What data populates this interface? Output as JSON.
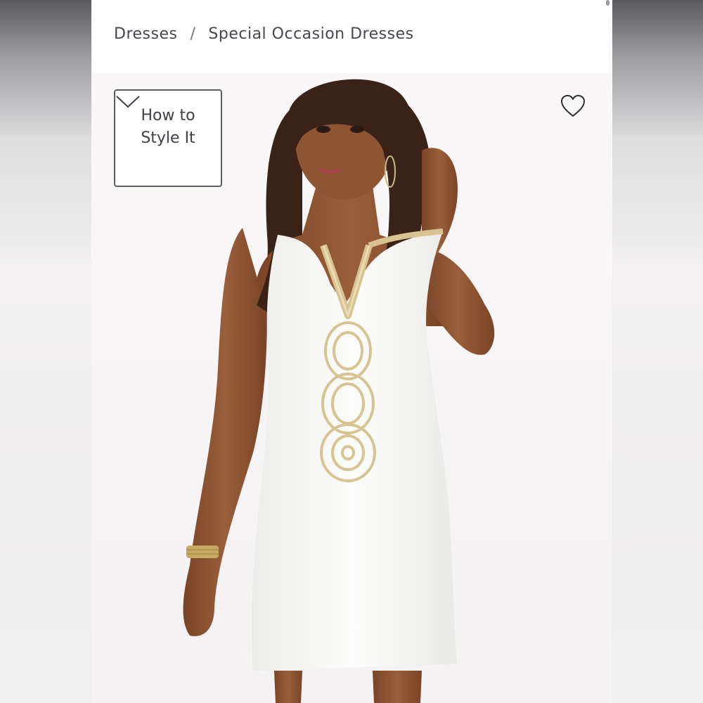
{
  "breadcrumb": {
    "items": [
      "Dresses",
      "Special Occasion Dresses"
    ],
    "separator": "/"
  },
  "style_it": {
    "label": "How to Style It",
    "icon": "chevron-down-icon"
  },
  "favorite": {
    "icon": "heart-outline-icon"
  },
  "product_image": {
    "subject": "product-photo",
    "colors": {
      "background": "#f7f5f5",
      "dress": "#fbfbfa",
      "trim": "#d8c493",
      "skin": "#8a5232",
      "hair": "#3b2218"
    }
  }
}
